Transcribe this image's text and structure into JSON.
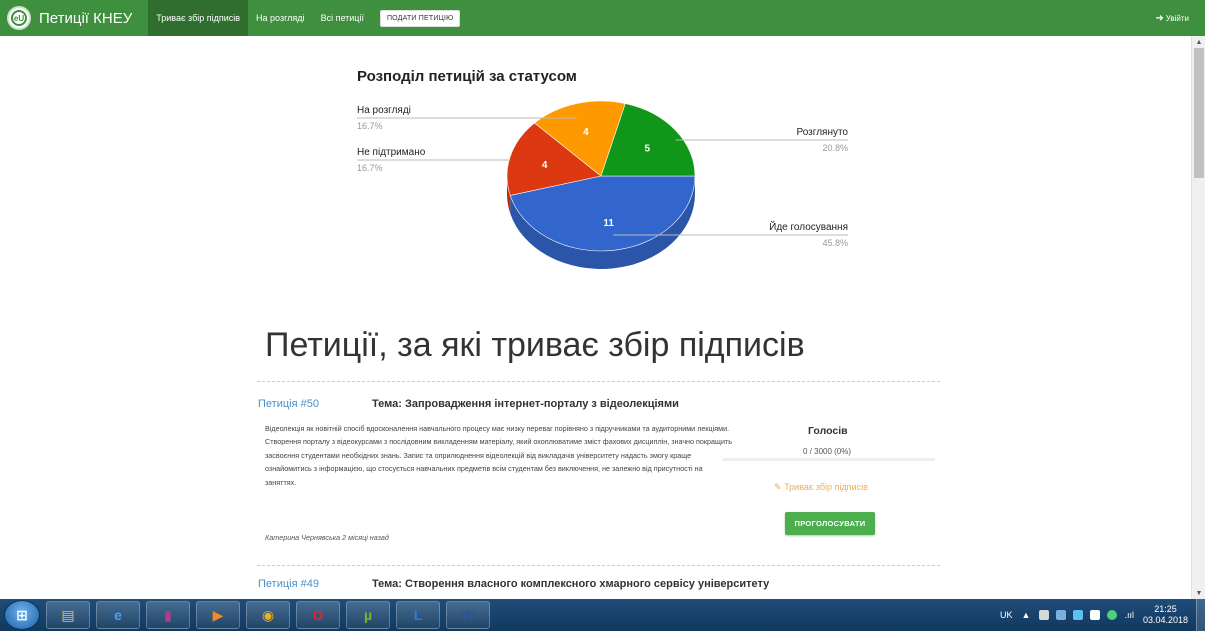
{
  "navbar": {
    "logo_text": "eU",
    "brand": "Петиції КНЕУ",
    "items": [
      {
        "label": "Триває збір підписів",
        "active": true
      },
      {
        "label": "На розгляді",
        "active": false
      },
      {
        "label": "Всі петиції",
        "active": false
      }
    ],
    "submit_button": "ПОДАТИ ПЕТИЦІЮ",
    "login": "Увійти",
    "login_icon": "sign-in-icon"
  },
  "chart_title": "Розподіл петицій за статусом",
  "chart_data": {
    "type": "pie",
    "title": "Розподіл петицій за статусом",
    "series": [
      {
        "name": "Йде голосування",
        "value": 11,
        "percent": "45.8%",
        "color": "#3366cc",
        "dark": "#2a55a8"
      },
      {
        "name": "Не підтримано",
        "value": 4,
        "percent": "16.7%",
        "color": "#dc3912",
        "dark": "#b52e0e"
      },
      {
        "name": "На розгляді",
        "value": 4,
        "percent": "16.7%",
        "color": "#ff9900",
        "dark": "#cc7a00"
      },
      {
        "name": "Розглянуто",
        "value": 5,
        "percent": "20.8%",
        "color": "#109618",
        "dark": "#0c7613"
      }
    ],
    "legend": "labeled-lines",
    "style": "3d"
  },
  "section_title": "Петиції, за які триває збір підписів",
  "petitions": [
    {
      "number": "Петиція #50",
      "topic": "Тема: Запровадження інтернет-порталу з відеолекціями",
      "description": "Відеолекція як новітній спосіб вдосконалення навчального процесу має низку переваг порівняно з підручниками та аудиторними лекціями. Створення порталу з відеокурсами з послідовним викладенням матеріалу, який охоплюватиме зміст фахових дисциплін, значно покращить засвоєння студентами необхідних знань. Запис та оприлюднення відеолекцій від викладачів університету надасть змогу краще ознайомитись з інформацією, що стосується навчальних предметів всім студентам без виключення, не залежно від присутності на заняттях.",
      "author": "Катерина Чернявська 2 місяці назад",
      "votes_title": "Голосів",
      "votes_count": "0 / 3000 (0%)",
      "votes_progress": 0,
      "status": "Триває збір підписів",
      "status_icon": "edit-icon",
      "vote_button": "ПРОГОЛОСУВАТИ"
    },
    {
      "number": "Петиція #49",
      "topic": "Тема: Створення власного комплексного хмарного сервісу університету"
    }
  ],
  "taskbar": {
    "start_icon": "windows-start-icon",
    "apps": [
      {
        "icon": "file-explorer-icon",
        "glyph": "▤",
        "color": "#e8c15a"
      },
      {
        "icon": "internet-explorer-icon",
        "glyph": "e",
        "color": "#4aa3e8"
      },
      {
        "icon": "winrar-icon",
        "glyph": "▮",
        "color": "#b43a8a"
      },
      {
        "icon": "media-player-icon",
        "glyph": "▶",
        "color": "#f08a24"
      },
      {
        "icon": "chrome-icon",
        "glyph": "◉",
        "color": "#e8b023"
      },
      {
        "icon": "opera-icon",
        "glyph": "O",
        "color": "#e0262a"
      },
      {
        "icon": "utorrent-icon",
        "glyph": "µ",
        "color": "#76b82a"
      },
      {
        "icon": "lingvo-icon",
        "glyph": "L",
        "color": "#2a7fd4"
      },
      {
        "icon": "word-icon",
        "glyph": "W",
        "color": "#2b5797"
      }
    ],
    "language": "UK",
    "clock_time": "21:25",
    "clock_date": "03.04.2018"
  }
}
